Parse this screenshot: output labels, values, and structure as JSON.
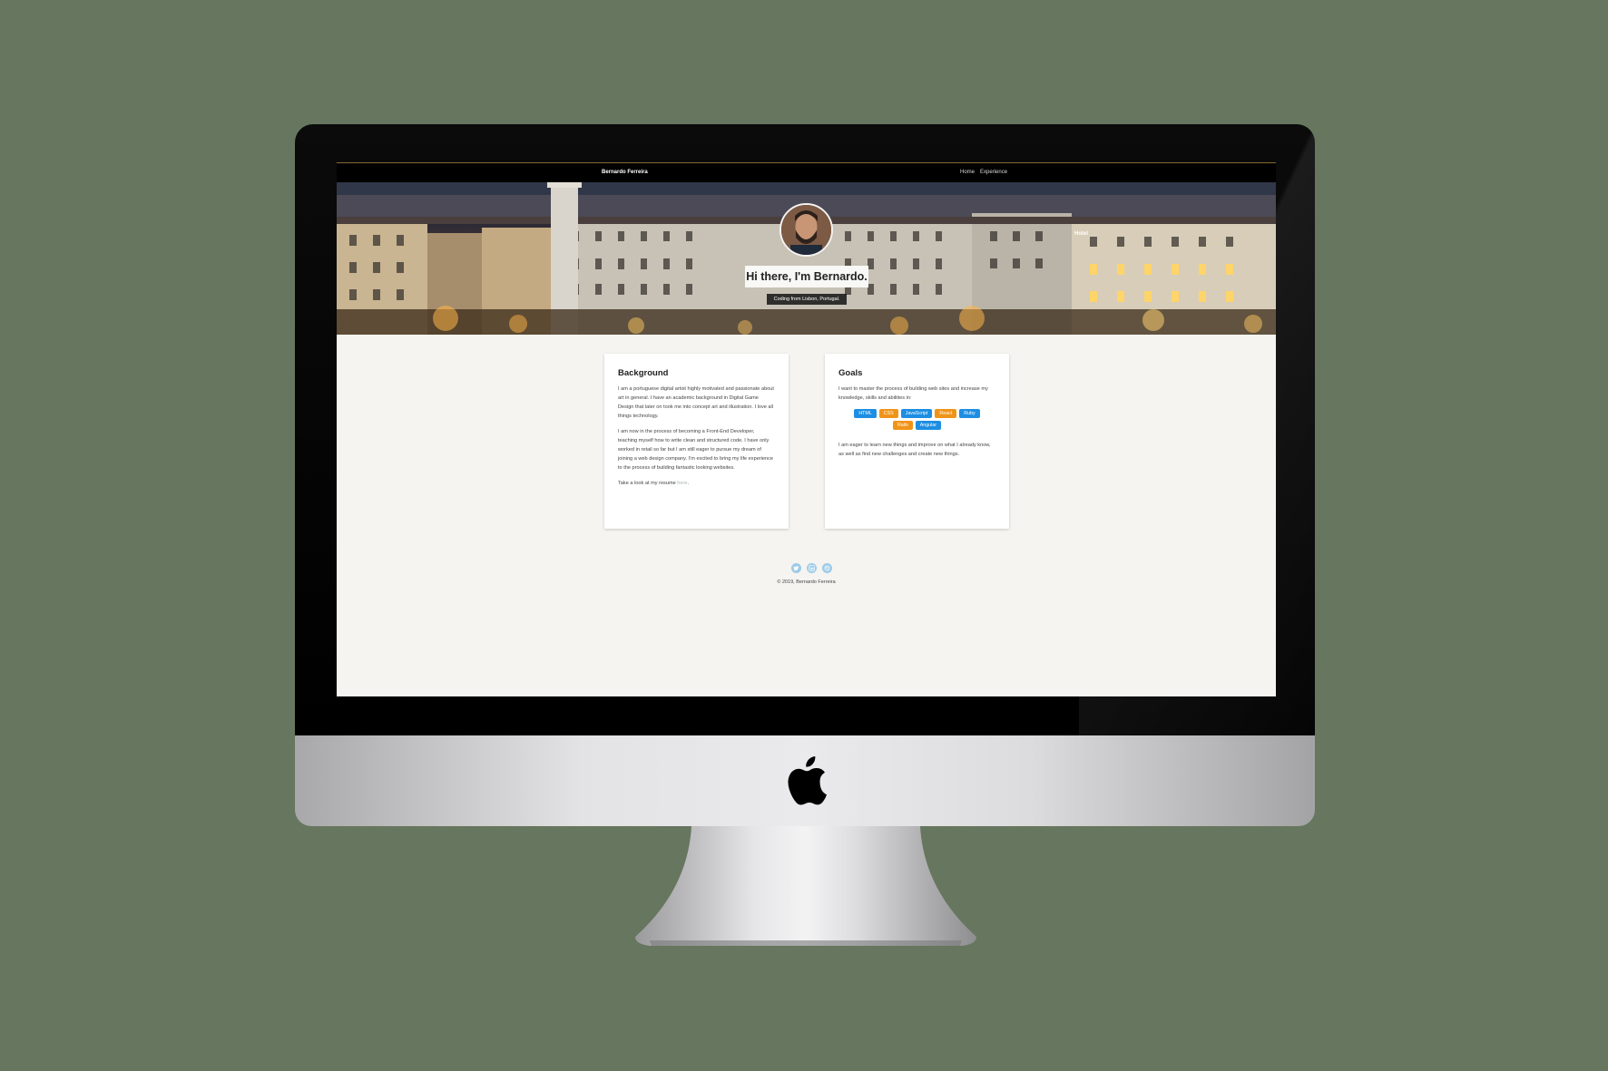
{
  "nav": {
    "brand": "Bernardo Ferreira",
    "links": [
      "Home",
      "Experience"
    ]
  },
  "hero": {
    "title": "Hi there, I'm Bernardo.",
    "subtitle": "Coding from Lisbon, Portugal.",
    "sign_text": "Hotel"
  },
  "background_card": {
    "heading": "Background",
    "p1": "I am a portuguese digital artist highly motivated and passionate about art in general. I have an academic background in Digital Game Design that later on took me into concept art and illustration. I love all things technology.",
    "p2": "I am now in the process of becoming a Front-End Developer, teaching myself how to write clean and structured code. I have only worked in retail so far but I am still eager to pursue my dream of joining a web design company. I'm excited to bring my life experience to the process of building fantastic looking websites.",
    "p3_prefix": "Take a look at my resume ",
    "p3_link": "here",
    "p3_suffix": "."
  },
  "goals_card": {
    "heading": "Goals",
    "p1": "I want to master the process of building web sites and increase my knowledge, skills and abilities in:",
    "tags": [
      {
        "label": "HTML",
        "color": "#1d8ee2"
      },
      {
        "label": "CSS",
        "color": "#f09419"
      },
      {
        "label": "JavaScript",
        "color": "#1d8ee2"
      },
      {
        "label": "React",
        "color": "#f09419"
      },
      {
        "label": "Ruby",
        "color": "#1d8ee2"
      },
      {
        "label": "Rails",
        "color": "#f09419"
      },
      {
        "label": "Angular",
        "color": "#1d8ee2"
      }
    ],
    "p2": "I am eager to learn new things and improve on what I already know, as well as find new challenges and create new things."
  },
  "footer": {
    "icons": [
      "twitter-icon",
      "linkedin-icon",
      "dribbble-icon"
    ],
    "copyright": "© 2019, Bernardo Ferreira"
  },
  "colors": {
    "backdrop": "#66765f",
    "tag_blue": "#1d8ee2",
    "tag_orange": "#f09419",
    "page_bg": "#f5f4f0",
    "social_icon": "#9ccbe8"
  }
}
